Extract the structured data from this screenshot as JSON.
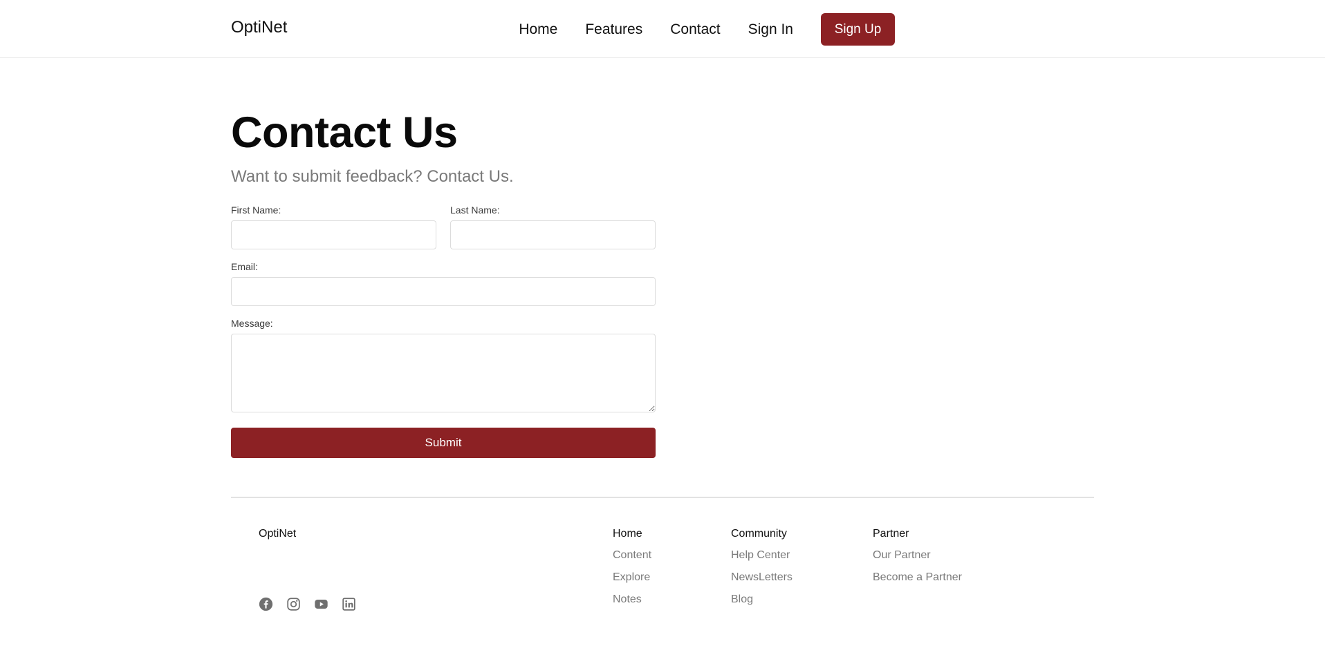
{
  "header": {
    "brand": "OptiNet",
    "nav": [
      "Home",
      "Features",
      "Contact",
      "Sign In"
    ],
    "signup_label": "Sign Up"
  },
  "main": {
    "title": "Contact Us",
    "subtitle": "Want to submit feedback? Contact Us.",
    "form": {
      "first_name_label": "First Name:",
      "first_name_value": "",
      "last_name_label": "Last Name:",
      "last_name_value": "",
      "email_label": "Email:",
      "email_value": "",
      "message_label": "Message:",
      "message_value": "",
      "submit_label": "Submit"
    }
  },
  "footer": {
    "brand": "OptiNet",
    "socials": [
      "facebook-icon",
      "instagram-icon",
      "youtube-icon",
      "linkedin-icon"
    ],
    "columns": [
      {
        "heading": "Home",
        "links": [
          "Content",
          "Explore",
          "Notes"
        ]
      },
      {
        "heading": "Community",
        "links": [
          "Help Center",
          "NewsLetters",
          "Blog"
        ]
      },
      {
        "heading": "Partner",
        "links": [
          "Our Partner",
          "Become a Partner"
        ]
      }
    ]
  },
  "colors": {
    "accent": "#8c2124",
    "muted_text": "#7a7a7a",
    "border": "#dcdcdc"
  }
}
